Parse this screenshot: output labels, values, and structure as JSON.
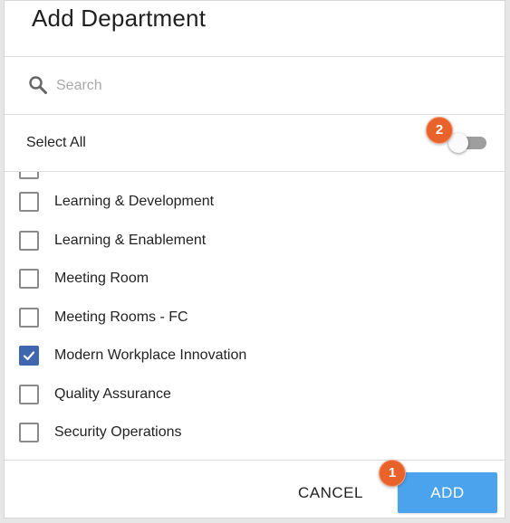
{
  "dialog": {
    "title": "Add Department",
    "search": {
      "placeholder": "Search",
      "value": ""
    },
    "select_all": {
      "label": "Select All",
      "toggle_on": false
    },
    "items": [
      {
        "label": "Learning & Development",
        "checked": false
      },
      {
        "label": "Learning & Enablement",
        "checked": false
      },
      {
        "label": "Meeting Room",
        "checked": false
      },
      {
        "label": "Meeting Rooms - FC",
        "checked": false
      },
      {
        "label": "Modern Workplace Innovation",
        "checked": true
      },
      {
        "label": "Quality Assurance",
        "checked": false
      },
      {
        "label": "Security Operations",
        "checked": false
      }
    ],
    "footer": {
      "cancel_label": "CANCEL",
      "add_label": "ADD"
    }
  },
  "annotations": {
    "badge_1": "1",
    "badge_2": "2"
  },
  "colors": {
    "accent": "#4aa3ec",
    "checkbox_checked": "#3f67b0",
    "badge": "#e8622a",
    "toggle_track_off": "#9e9e9e"
  },
  "icons": {
    "search": "search-icon",
    "check": "checkmark-icon"
  }
}
